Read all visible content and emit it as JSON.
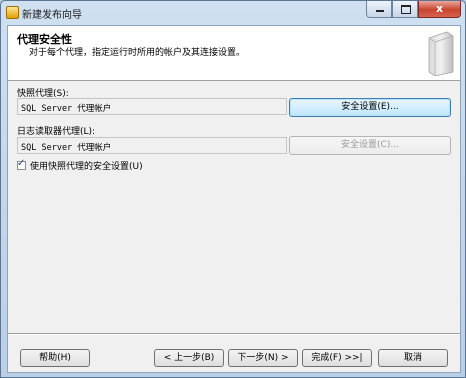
{
  "window": {
    "title": "新建发布向导",
    "close_glyph": "x",
    "minimize_glyph": "",
    "maximize_glyph": ""
  },
  "header": {
    "title": "代理安全性",
    "description": "对于每个代理，指定运行时所用的帐户及其连接设置。"
  },
  "snapshot_agent": {
    "label": "快照代理(S):",
    "value": "SQL Server 代理帐户",
    "security_button": "安全设置(E)..."
  },
  "log_reader_agent": {
    "label": "日志读取器代理(L):",
    "value": "SQL Server 代理帐户",
    "security_button": "安全设置(C)..."
  },
  "use_snapshot_security": {
    "label": "使用快照代理的安全设置(U)",
    "checked": true,
    "tick": "✓"
  },
  "footer": {
    "help": "帮助(H)",
    "back": "< 上一步(B)",
    "next": "下一步(N) >",
    "finish": "完成(F) >>|",
    "cancel": "取消"
  }
}
